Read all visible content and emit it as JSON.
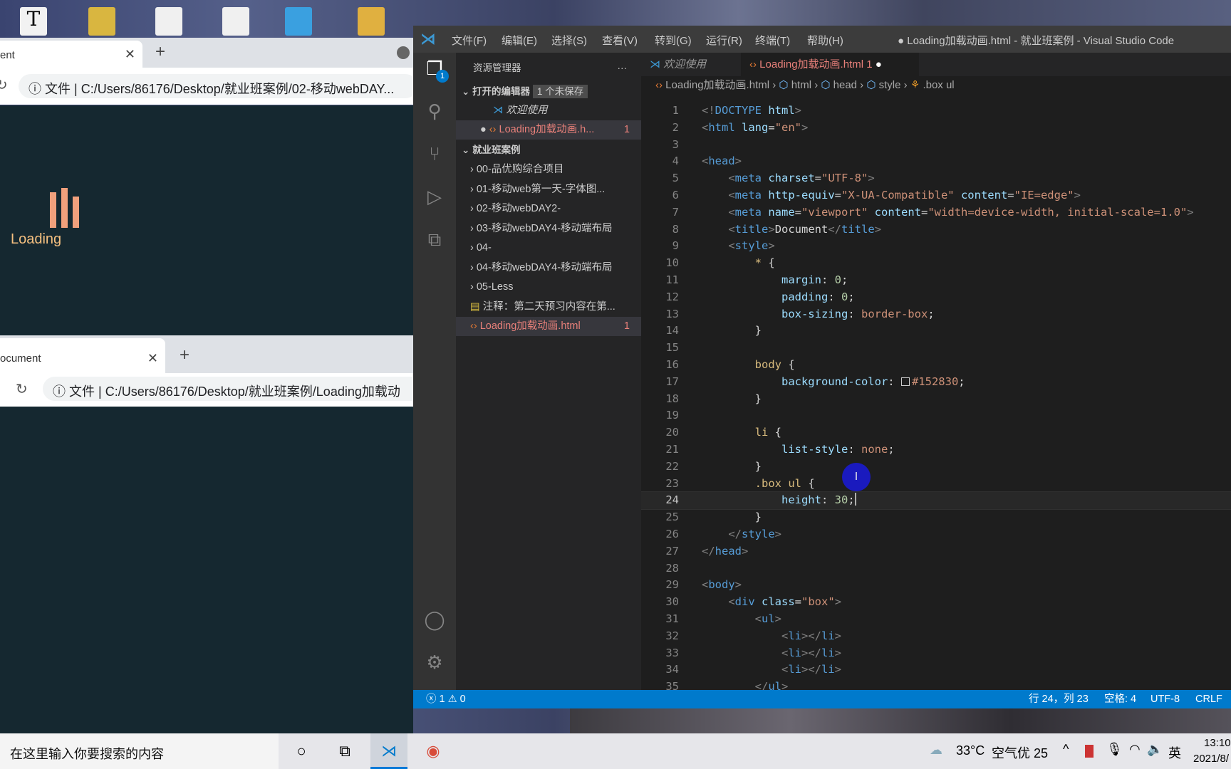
{
  "colors": {
    "accent": "#007acc",
    "browser_bg": "#152830",
    "loading": "#f0a07c",
    "modified_file": "#e8807a"
  },
  "browser_top": {
    "tab_title": "ent",
    "address_prefix": "文件",
    "address": "C:/Users/86176/Desktop/就业班案例/02-移动webDAY...",
    "loading_text": "Loading"
  },
  "browser_bottom": {
    "tab_title": "ocument",
    "address_prefix": "文件",
    "address": "C:/Users/86176/Desktop/就业班案例/Loading加载动"
  },
  "vscode": {
    "menu": [
      "文件(F)",
      "编辑(E)",
      "选择(S)",
      "查看(V)",
      "转到(G)",
      "运行(R)",
      "终端(T)",
      "帮助(H)"
    ],
    "window_title": "● Loading加载动画.html - 就业班案例 - Visual Studio Code",
    "explorer_badge": "1",
    "sidebar": {
      "title": "资源管理器",
      "more": "···",
      "open_editors": "打开的编辑器",
      "unsaved": "1 个未保存",
      "open_items": [
        {
          "label": "欢迎使用"
        },
        {
          "label": "Loading加载动画.h...",
          "badge": "1"
        }
      ],
      "folder": "就业班案例",
      "items": [
        {
          "label": "00-品优购综合项目",
          "type": "folder"
        },
        {
          "label": "01-移动web第一天-字体图...",
          "type": "folder"
        },
        {
          "label": "02-移动webDAY2-",
          "type": "folder"
        },
        {
          "label": "03-移动webDAY4-移动端布局",
          "type": "folder"
        },
        {
          "label": "04-",
          "type": "folder"
        },
        {
          "label": "04-移动webDAY4-移动端布局",
          "type": "folder"
        },
        {
          "label": "05-Less",
          "type": "folder"
        },
        {
          "label": "注释：第二天预习内容在第...",
          "type": "note"
        },
        {
          "label": "Loading加载动画.html",
          "type": "html",
          "badge": "1"
        }
      ]
    },
    "tabs": [
      {
        "label": "欢迎使用"
      },
      {
        "label": "Loading加载动画.html 1"
      }
    ],
    "breadcrumb": [
      "Loading加载动画.html",
      "html",
      "head",
      "style",
      ".box ul"
    ],
    "current_line": 24,
    "code": [
      [
        [
          "p",
          "<!"
        ],
        [
          "t",
          "DOCTYPE"
        ],
        [
          "a",
          " html"
        ],
        [
          "p",
          ">"
        ]
      ],
      [
        [
          "p",
          "<"
        ],
        [
          "t",
          "html"
        ],
        [
          "a",
          " lang"
        ],
        [
          "x",
          "="
        ],
        [
          "s",
          "\"en\""
        ],
        [
          "p",
          ">"
        ]
      ],
      [],
      [
        [
          "p",
          "<"
        ],
        [
          "t",
          "head"
        ],
        [
          "p",
          ">"
        ]
      ],
      [
        [
          "x",
          "    "
        ],
        [
          "p",
          "<"
        ],
        [
          "t",
          "meta"
        ],
        [
          "a",
          " charset"
        ],
        [
          "x",
          "="
        ],
        [
          "s",
          "\"UTF-8\""
        ],
        [
          "p",
          ">"
        ]
      ],
      [
        [
          "x",
          "    "
        ],
        [
          "p",
          "<"
        ],
        [
          "t",
          "meta"
        ],
        [
          "a",
          " http-equiv"
        ],
        [
          "x",
          "="
        ],
        [
          "s",
          "\"X-UA-Compatible\""
        ],
        [
          "a",
          " content"
        ],
        [
          "x",
          "="
        ],
        [
          "s",
          "\"IE=edge\""
        ],
        [
          "p",
          ">"
        ]
      ],
      [
        [
          "x",
          "    "
        ],
        [
          "p",
          "<"
        ],
        [
          "t",
          "meta"
        ],
        [
          "a",
          " name"
        ],
        [
          "x",
          "="
        ],
        [
          "s",
          "\"viewport\""
        ],
        [
          "a",
          " content"
        ],
        [
          "x",
          "="
        ],
        [
          "s",
          "\"width=device-width, initial-scale=1.0\""
        ],
        [
          "p",
          ">"
        ]
      ],
      [
        [
          "x",
          "    "
        ],
        [
          "p",
          "<"
        ],
        [
          "t",
          "title"
        ],
        [
          "p",
          ">"
        ],
        [
          "x",
          "Document"
        ],
        [
          "p",
          "</"
        ],
        [
          "t",
          "title"
        ],
        [
          "p",
          ">"
        ]
      ],
      [
        [
          "x",
          "    "
        ],
        [
          "p",
          "<"
        ],
        [
          "t",
          "style"
        ],
        [
          "p",
          ">"
        ]
      ],
      [
        [
          "x",
          "        "
        ],
        [
          "sel",
          "*"
        ],
        [
          "x",
          " {"
        ]
      ],
      [
        [
          "x",
          "            "
        ],
        [
          "pr",
          "margin"
        ],
        [
          "x",
          ": "
        ],
        [
          "n",
          "0"
        ],
        [
          "x",
          ";"
        ]
      ],
      [
        [
          "x",
          "            "
        ],
        [
          "pr",
          "padding"
        ],
        [
          "x",
          ": "
        ],
        [
          "n",
          "0"
        ],
        [
          "x",
          ";"
        ]
      ],
      [
        [
          "x",
          "            "
        ],
        [
          "pr",
          "box-sizing"
        ],
        [
          "x",
          ": "
        ],
        [
          "v",
          "border-box"
        ],
        [
          "x",
          ";"
        ]
      ],
      [
        [
          "x",
          "        }"
        ]
      ],
      [],
      [
        [
          "x",
          "        "
        ],
        [
          "sel",
          "body"
        ],
        [
          "x",
          " {"
        ]
      ],
      [
        [
          "x",
          "            "
        ],
        [
          "pr",
          "background-color"
        ],
        [
          "x",
          ": "
        ],
        [
          "sw",
          ""
        ],
        [
          "v",
          "#152830"
        ],
        [
          "x",
          ";"
        ]
      ],
      [
        [
          "x",
          "        }"
        ]
      ],
      [],
      [
        [
          "x",
          "        "
        ],
        [
          "sel",
          "li"
        ],
        [
          "x",
          " {"
        ]
      ],
      [
        [
          "x",
          "            "
        ],
        [
          "pr",
          "list-style"
        ],
        [
          "x",
          ": "
        ],
        [
          "v",
          "none"
        ],
        [
          "x",
          ";"
        ]
      ],
      [
        [
          "x",
          "        }"
        ]
      ],
      [
        [
          "x",
          "        "
        ],
        [
          "sel",
          ".box ul"
        ],
        [
          "x",
          " {"
        ]
      ],
      [
        [
          "x",
          "            "
        ],
        [
          "pr",
          "height"
        ],
        [
          "x",
          ": "
        ],
        [
          "n",
          "30"
        ],
        [
          "x",
          ";"
        ]
      ],
      [
        [
          "x",
          "        }"
        ]
      ],
      [
        [
          "x",
          "    "
        ],
        [
          "p",
          "</"
        ],
        [
          "t",
          "style"
        ],
        [
          "p",
          ">"
        ]
      ],
      [
        [
          "p",
          "</"
        ],
        [
          "t",
          "head"
        ],
        [
          "p",
          ">"
        ]
      ],
      [],
      [
        [
          "p",
          "<"
        ],
        [
          "t",
          "body"
        ],
        [
          "p",
          ">"
        ]
      ],
      [
        [
          "x",
          "    "
        ],
        [
          "p",
          "<"
        ],
        [
          "t",
          "div"
        ],
        [
          "a",
          " class"
        ],
        [
          "x",
          "="
        ],
        [
          "s",
          "\"box\""
        ],
        [
          "p",
          ">"
        ]
      ],
      [
        [
          "x",
          "        "
        ],
        [
          "p",
          "<"
        ],
        [
          "t",
          "ul"
        ],
        [
          "p",
          ">"
        ]
      ],
      [
        [
          "x",
          "            "
        ],
        [
          "p",
          "<"
        ],
        [
          "t",
          "li"
        ],
        [
          "p",
          "></"
        ],
        [
          "t",
          "li"
        ],
        [
          "p",
          ">"
        ]
      ],
      [
        [
          "x",
          "            "
        ],
        [
          "p",
          "<"
        ],
        [
          "t",
          "li"
        ],
        [
          "p",
          "></"
        ],
        [
          "t",
          "li"
        ],
        [
          "p",
          ">"
        ]
      ],
      [
        [
          "x",
          "            "
        ],
        [
          "p",
          "<"
        ],
        [
          "t",
          "li"
        ],
        [
          "p",
          "></"
        ],
        [
          "t",
          "li"
        ],
        [
          "p",
          ">"
        ]
      ],
      [
        [
          "x",
          "        "
        ],
        [
          "p",
          "</"
        ],
        [
          "t",
          "ul"
        ],
        [
          "p",
          ">"
        ]
      ]
    ],
    "status": {
      "errors": "1",
      "warnings": "0",
      "position": "行 24，列 23",
      "spaces": "空格: 4",
      "encoding": "UTF-8",
      "eol": "CRLF"
    }
  },
  "taskbar": {
    "search_placeholder": "在这里输入你要搜索的内容",
    "weather": "33°C",
    "air": "空气优 25",
    "ime": "英",
    "time": "13:10",
    "date": "2021/8/"
  }
}
